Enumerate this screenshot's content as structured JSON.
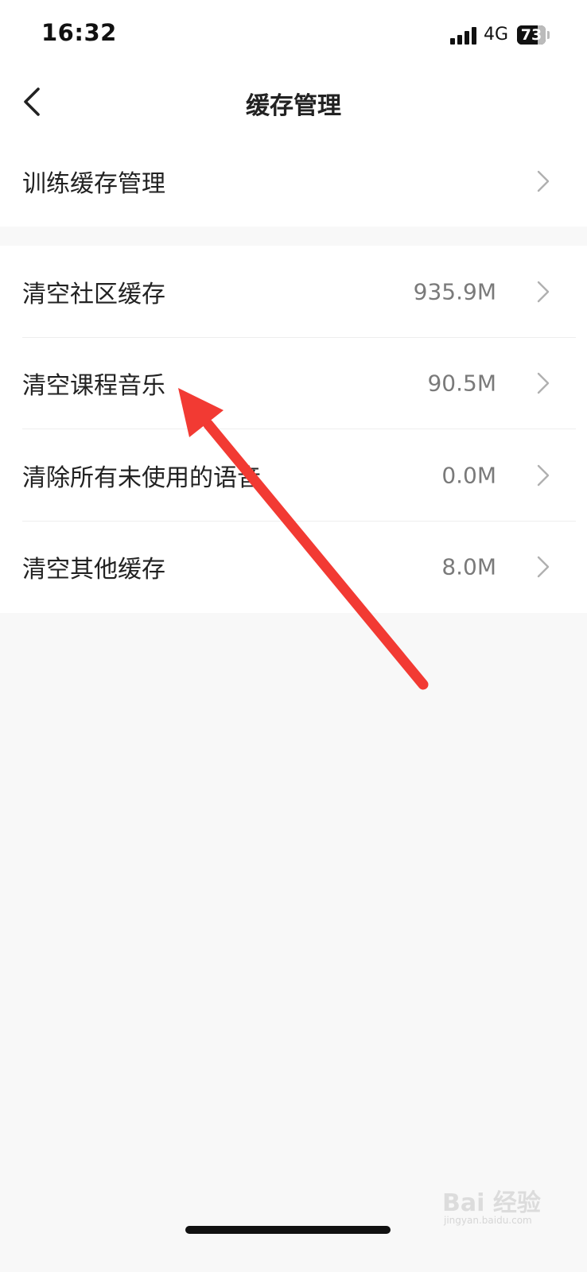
{
  "status_bar": {
    "time": "16:32",
    "network": "4G",
    "battery": "73",
    "battery_fraction": 0.73
  },
  "nav": {
    "title": "缓存管理",
    "back_icon": "chevron-left-icon"
  },
  "group_1": [
    {
      "label": "训练缓存管理",
      "value": ""
    }
  ],
  "group_2": [
    {
      "label": "清空社区缓存",
      "value": "935.9M"
    },
    {
      "label": "清空课程音乐",
      "value": "90.5M"
    },
    {
      "label": "清除所有未使用的语音",
      "value": "0.0M"
    },
    {
      "label": "清空其他缓存",
      "value": "8.0M"
    }
  ],
  "row_chevron_icon": "chevron-right-icon",
  "annotation": {
    "arrow_color": "#f23a33",
    "points_to": "清空课程音乐"
  },
  "watermark": {
    "brand": "Bai 经验",
    "url": "jingyan.baidu.com"
  }
}
